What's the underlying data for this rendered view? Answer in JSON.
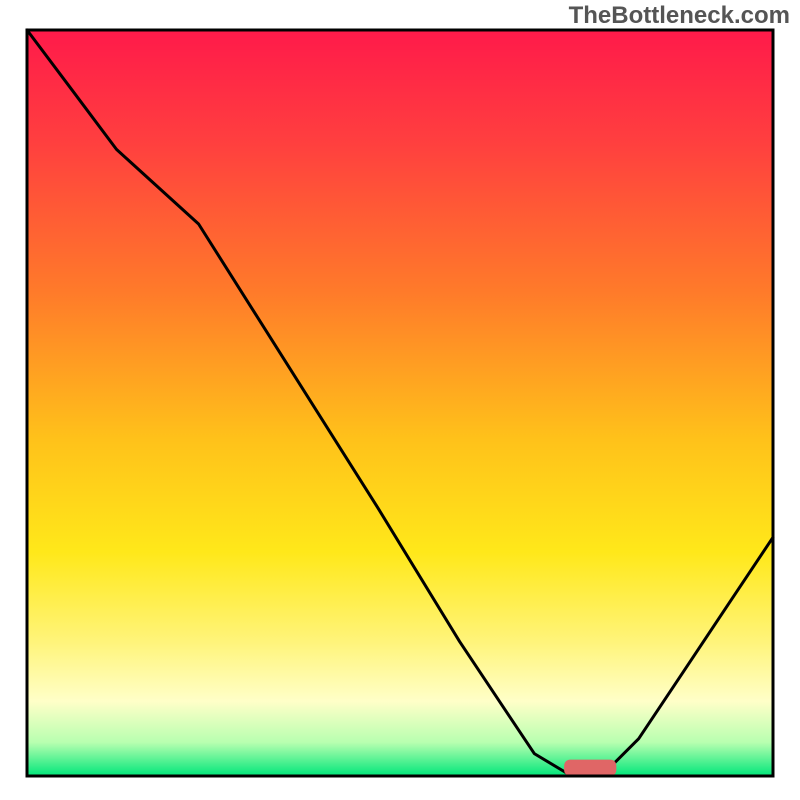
{
  "watermark": "TheBottleneck.com",
  "chart_data": {
    "type": "line",
    "title": "",
    "xlabel": "",
    "ylabel": "",
    "xlim": [
      0,
      100
    ],
    "ylim": [
      0,
      100
    ],
    "background_gradient": {
      "stops": [
        {
          "offset": 0.0,
          "color": "#ff1a4a"
        },
        {
          "offset": 0.15,
          "color": "#ff3f3f"
        },
        {
          "offset": 0.35,
          "color": "#ff7a2a"
        },
        {
          "offset": 0.55,
          "color": "#ffc21a"
        },
        {
          "offset": 0.7,
          "color": "#ffe81a"
        },
        {
          "offset": 0.82,
          "color": "#fff47a"
        },
        {
          "offset": 0.9,
          "color": "#ffffc8"
        },
        {
          "offset": 0.955,
          "color": "#b8ffb0"
        },
        {
          "offset": 1.0,
          "color": "#00e67a"
        }
      ]
    },
    "series": [
      {
        "name": "bottleneck-curve",
        "color": "#000000",
        "x": [
          0,
          6,
          12,
          23,
          35,
          47,
          58,
          68,
          73,
          77,
          82,
          88,
          94,
          100
        ],
        "y": [
          100,
          92,
          84,
          74,
          55,
          36,
          18,
          3,
          0,
          0,
          5,
          14,
          23,
          32
        ]
      }
    ],
    "marker": {
      "name": "optimal-zone",
      "color": "#e06666",
      "x_start": 72,
      "x_end": 79,
      "y": 0,
      "thickness": 2.2
    },
    "frame": {
      "color": "#000000",
      "width": 3
    }
  }
}
